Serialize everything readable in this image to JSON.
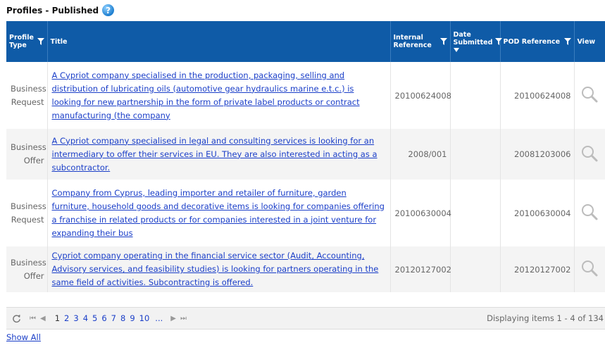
{
  "panel": {
    "title": "Profiles - Published",
    "help_icon": "help-icon"
  },
  "columns": {
    "profile_type": "Profile Type",
    "title": "Title",
    "internal_reference": "Internal Reference",
    "date_submitted": "Date Submitted",
    "pod_reference": "POD Reference",
    "view": "View"
  },
  "rows": [
    {
      "type": "Business Request",
      "title": "A Cypriot company specialised in the production, packaging, selling and distribution of lubricating oils (automotive gear hydraulics marine e.t.c.) is looking for new partnership in the form of private label products or contract manufacturing (the company",
      "internal_reference": "20100624008",
      "date_submitted": "",
      "pod_reference": "20100624008"
    },
    {
      "type": "Business Offer",
      "title": "A Cypriot company specialised in legal and consulting services is looking for an intermediary to offer their services in EU. They are also interested in acting as a subcontractor.",
      "internal_reference": "2008/001",
      "date_submitted": "",
      "pod_reference": "20081203006"
    },
    {
      "type": "Business Request",
      "title": "Company from Cyprus, leading importer and retailer of furniture, garden furniture, household goods and decorative items is looking for companies offering a franchise in related products or for companies interested in a joint venture for expanding their bus",
      "internal_reference": "20100630004",
      "date_submitted": "",
      "pod_reference": "20100630004"
    },
    {
      "type": "Business Offer",
      "title": "Cypriot company operating in the financial service sector (Audit, Accounting, Advisory services, and feasibility studies) is looking for partners operating in the same field of activities. Subcontracting is offered.",
      "internal_reference": "20120127002",
      "date_submitted": "",
      "pod_reference": "20120127002"
    }
  ],
  "pager": {
    "first": "⏮",
    "prev": "◀",
    "next": "▶",
    "last": "⏭",
    "pages": [
      "1",
      "2",
      "3",
      "4",
      "5",
      "6",
      "7",
      "8",
      "9",
      "10"
    ],
    "current_page": "1",
    "ellipsis": "...",
    "info": "Displaying items 1 - 4 of 134"
  },
  "footer": {
    "show_all": "Show All"
  },
  "colors": {
    "header_bg": "#0f5ba7",
    "link": "#1a3ec8",
    "alt_row": "#f4f4f4"
  }
}
